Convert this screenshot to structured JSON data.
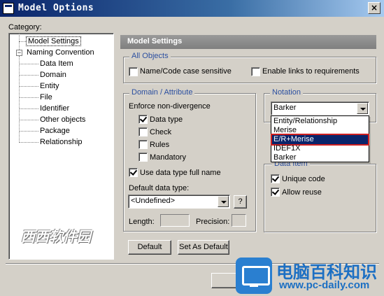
{
  "window": {
    "title": "Model Options",
    "close_glyph": "×"
  },
  "category": {
    "label": "Category:",
    "items": [
      "Model Settings",
      "Naming Convention",
      "Data Item",
      "Domain",
      "Entity",
      "File",
      "Identifier",
      "Other objects",
      "Package",
      "Relationship"
    ]
  },
  "panel": {
    "header": "Model Settings"
  },
  "all_objects": {
    "title": "All Objects",
    "name_code_case": {
      "label": "Name/Code case sensitive",
      "checked": false
    },
    "enable_links": {
      "label": "Enable links to requirements",
      "checked": false
    }
  },
  "domain_attribute": {
    "title": "Domain / Attribute",
    "enforce_label": "Enforce non-divergence",
    "data_type": {
      "label": "Data type",
      "checked": true
    },
    "check": {
      "label": "Check",
      "checked": false
    },
    "rules": {
      "label": "Rules",
      "checked": false
    },
    "mandatory": {
      "label": "Mandatory",
      "checked": false
    },
    "use_full_name": {
      "label": "Use data type full name",
      "checked": true
    },
    "default_type_label": "Default data type:",
    "default_type_value": "<Undefined>",
    "help_button": "?",
    "length_label": "Length:",
    "precision_label": "Precision:"
  },
  "notation": {
    "title": "Notation",
    "selected": "Barker",
    "options": [
      "Entity/Relationship",
      "Merise",
      "E/R+Merise",
      "IDEF1X",
      "Barker"
    ],
    "highlighted_option": "E/R+Merise"
  },
  "data_item": {
    "title": "Data Item",
    "unique_code": {
      "label": "Unique code",
      "checked": true
    },
    "allow_reuse": {
      "label": "Allow reuse",
      "checked": true
    }
  },
  "buttons": {
    "default": "Default",
    "set_as_default": "Set As Default",
    "ok_partial": "O"
  },
  "watermarks": {
    "left_text": "西西软件园",
    "right_cn": "电脑百科知识",
    "right_url": "www.pc-daily.com"
  }
}
